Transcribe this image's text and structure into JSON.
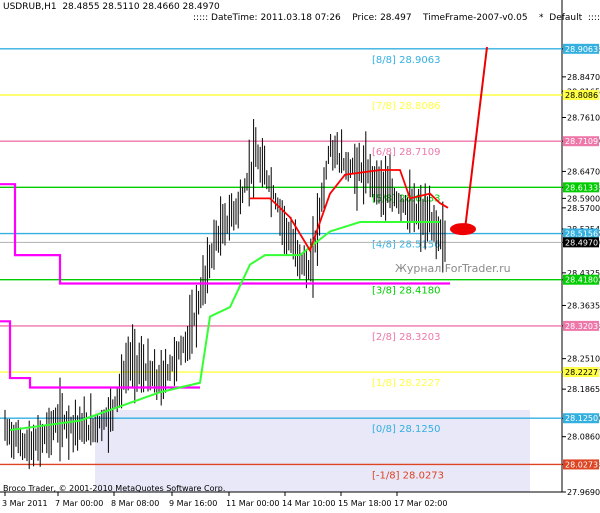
{
  "header": {
    "symbol_quote": "USDRUB,H1  28.4855 28.5110 28.4660 28.4970",
    "info": "::::: DateTime: 2011.03.18 07:26    Price: 28.497    TimeFrame-2007-v0.05    *  Default  :::::"
  },
  "footer": {
    "copyright": "Broco Trader, © 2001-2010 MetaQuotes Software Corp."
  },
  "watermark": "Журнал ForTrader.ru",
  "chart_data": {
    "type": "line",
    "title": "USDRUB,H1",
    "ylim": [
      27.969,
      28.963
    ],
    "y_ticks": [
      "28.9063",
      "28.8470",
      "28.8165",
      "28.7610",
      "28.7109",
      "28.6470",
      "28.6133",
      "28.5900",
      "28.5700",
      "28.5254",
      "28.5156",
      "28.4970",
      "28.4325",
      "28.4180",
      "28.3635",
      "28.3203",
      "28.2510",
      "28.2227",
      "28.1865",
      "28.1250",
      "28.0860",
      "28.0273",
      "27.9690"
    ],
    "x_ticks": [
      "3 Mar 2011",
      "7 Mar 00:00",
      "8 Mar 08:00",
      "9 Mar 16:00",
      "11 Mar 00:00",
      "14 Mar 10:00",
      "15 Mar 18:00",
      "17 Mar 02:00"
    ],
    "current_price": 28.497,
    "murrey_levels": [
      {
        "label": "[8/8]",
        "value": 28.9063,
        "color": "#33b0e0"
      },
      {
        "label": "[7/8]",
        "value": 28.8086,
        "color": "#ffff44"
      },
      {
        "label": "[6/8]",
        "value": 28.7109,
        "color": "#ee77aa"
      },
      {
        "label": "[5/8]",
        "value": 28.6133,
        "color": "#00cc00"
      },
      {
        "label": "[4/8]",
        "value": 28.5156,
        "color": "#33b0e0"
      },
      {
        "label": "[3/8]",
        "value": 28.418,
        "color": "#00cc00"
      },
      {
        "label": "[2/8]",
        "value": 28.3203,
        "color": "#ee77aa"
      },
      {
        "label": "[1/8]",
        "value": 28.2227,
        "color": "#ffff44"
      },
      {
        "label": "[0/8]",
        "value": 28.125,
        "color": "#33b0e0"
      },
      {
        "label": "[-1/8]",
        "value": 28.0273,
        "color": "#dd4422"
      }
    ],
    "price_axis_badges": [
      {
        "value": 28.9063,
        "text": "28.9063",
        "color": "#33b0e0"
      },
      {
        "value": 28.8086,
        "text": "28.8086",
        "color": "#ffff44"
      },
      {
        "value": 28.7109,
        "text": "28.7109",
        "color": "#ee77aa"
      },
      {
        "value": 28.6133,
        "text": "28.6133",
        "color": "#00cc00"
      },
      {
        "value": 28.5156,
        "text": "28.5156",
        "color": "#33b0e0"
      },
      {
        "value": 28.497,
        "text": "28.4970",
        "color": "#000000"
      },
      {
        "value": 28.418,
        "text": "28.4180",
        "color": "#00cc00"
      },
      {
        "value": 28.3203,
        "text": "28.3203",
        "color": "#ee77aa"
      },
      {
        "value": 28.2227,
        "text": "28.2227",
        "color": "#ffff44"
      },
      {
        "value": 28.125,
        "text": "28.1250",
        "color": "#33b0e0"
      },
      {
        "value": 28.0273,
        "text": "28.0273",
        "color": "#dd4422"
      }
    ],
    "magenta_line": [
      [
        0,
        28.62
      ],
      [
        15,
        28.62
      ],
      [
        15,
        28.47
      ],
      [
        60,
        28.47
      ],
      [
        60,
        28.41
      ],
      [
        450,
        28.41
      ]
    ],
    "magenta_lower": [
      [
        0,
        28.33
      ],
      [
        10,
        28.33
      ],
      [
        10,
        28.21
      ],
      [
        30,
        28.21
      ],
      [
        30,
        28.19
      ],
      [
        200,
        28.19
      ]
    ],
    "green_line": [
      [
        10,
        28.1
      ],
      [
        80,
        28.12
      ],
      [
        120,
        28.15
      ],
      [
        160,
        28.18
      ],
      [
        200,
        28.2
      ],
      [
        210,
        28.34
      ],
      [
        230,
        28.36
      ],
      [
        250,
        28.45
      ],
      [
        265,
        28.47
      ],
      [
        300,
        28.47
      ],
      [
        330,
        28.52
      ],
      [
        360,
        28.54
      ],
      [
        400,
        28.54
      ],
      [
        440,
        28.54
      ]
    ],
    "red_line": [
      [
        250,
        28.59
      ],
      [
        270,
        28.59
      ],
      [
        290,
        28.55
      ],
      [
        310,
        28.48
      ],
      [
        330,
        28.6
      ],
      [
        345,
        28.64
      ],
      [
        380,
        28.65
      ],
      [
        400,
        28.65
      ],
      [
        410,
        28.59
      ],
      [
        430,
        28.6
      ],
      [
        440,
        28.58
      ],
      [
        448,
        28.57
      ]
    ],
    "annotation": {
      "ellipse_at": [
        463,
        28.525
      ],
      "arrow_to": [
        487,
        28.91
      ]
    }
  }
}
